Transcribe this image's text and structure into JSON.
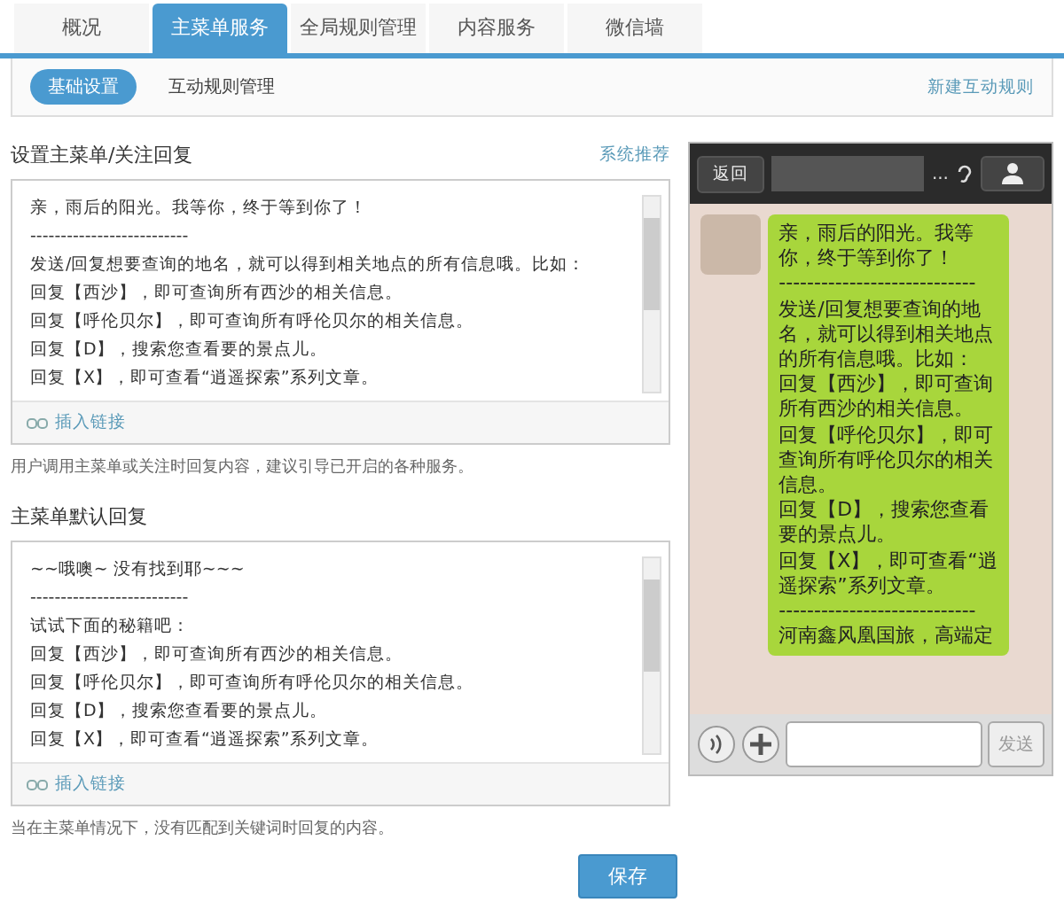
{
  "tabs": [
    {
      "label": "概况",
      "selected": false
    },
    {
      "label": "主菜单服务",
      "selected": true
    },
    {
      "label": "全局规则管理",
      "selected": false
    },
    {
      "label": "内容服务",
      "selected": false
    },
    {
      "label": "微信墙",
      "selected": false
    }
  ],
  "subtabs": [
    {
      "label": "基础设置",
      "selected": true
    },
    {
      "label": "互动规则管理",
      "selected": false
    }
  ],
  "new_rule_link": "新建互动规则",
  "sections": [
    {
      "title": "设置主菜单/关注回复",
      "link": "系统推荐",
      "lines": [
        "亲，雨后的阳光。我等你，终于等到你了！",
        "--------------------------",
        "发送/回复想要查询的地名，就可以得到相关地点的所有信息哦。比如：",
        "回复【西沙】，即可查询所有西沙的相关信息。",
        "回复【呼伦贝尔】，即可查询所有呼伦贝尔的相关信息。",
        "回复【D】，搜索您查看要的景点儿。",
        "回复【X】，即可查看“逍遥探索”系列文章。"
      ],
      "insert_link": "插入链接",
      "hint": "用户调用主菜单或关注时回复内容，建议引导已开启的各种服务。"
    },
    {
      "title": "主菜单默认回复",
      "lines": [
        "~~哦噢~ 没有找到耶~~~",
        "--------------------------",
        "试试下面的秘籍吧：",
        "回复【西沙】，即可查询所有西沙的相关信息。",
        "回复【呼伦贝尔】，即可查询所有呼伦贝尔的相关信息。",
        "回复【D】，搜索您查看要的景点儿。",
        "回复【X】，即可查看“逍遥探索”系列文章。"
      ],
      "insert_link": "插入链接",
      "hint": "当在主菜单情况下，没有匹配到关键词时回复的内容。"
    }
  ],
  "save_button": "保存",
  "phone": {
    "back": "返回",
    "more": "...",
    "bubble": [
      "亲，雨后的阳光。我等你，终于等到你了！",
      "----------------------------",
      "发送/回复想要查询的地名，就可以得到相关地点的所有信息哦。比如：",
      "回复【西沙】，即可查询所有西沙的相关信息。",
      "回复【呼伦贝尔】，即可查询所有呼伦贝尔的相关信息。",
      "回复【D】，搜索您查看要的景点儿。",
      "回复【X】，即可查看“逍遥探索”系列文章。",
      "----------------------------",
      "河南鑫风凰国旅，高端定"
    ],
    "send": "发送"
  }
}
